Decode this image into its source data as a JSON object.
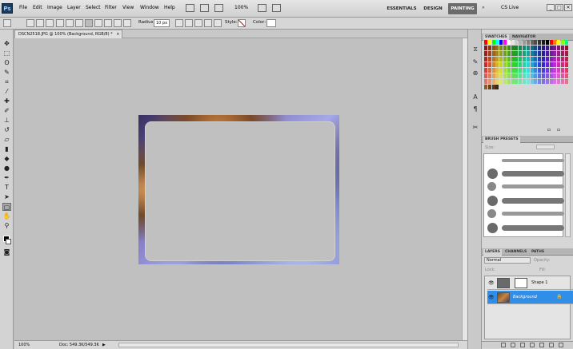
{
  "menubar": {
    "logo": "Ps",
    "items": [
      "File",
      "Edit",
      "Image",
      "Layer",
      "Select",
      "Filter",
      "View",
      "Window",
      "Help"
    ],
    "zoom_value": "100%",
    "workspaces": [
      "ESSENTIALS",
      "DESIGN",
      "PAINTING"
    ],
    "active_workspace": "PAINTING",
    "cs_live": "CS Live",
    "window_controls": [
      "_",
      "□",
      "✕"
    ]
  },
  "options_bar": {
    "radius_label": "Radius:",
    "radius_value": "10 px",
    "style_label": "Style:",
    "color_label": "Color:"
  },
  "document": {
    "tab_title": "DSCN2518.JPG @ 100% (Background, RGB/8) *",
    "tab_close": "×",
    "zoom": "100%",
    "doc_info": "Doc: 549.3K/549.3K"
  },
  "panels": {
    "swatches_tabs": [
      "SWATCHES",
      "NAVIGATOR"
    ],
    "brush_tab": "BRUSH PRESETS",
    "brush_size_label": "Size:",
    "layers_tabs": [
      "LAYERS",
      "CHANNELS",
      "PATHS"
    ],
    "blend_mode": "Normal",
    "opacity_label": "Opacity:",
    "lock_label": "Lock:",
    "fill_label": "Fill:",
    "layers": [
      {
        "name": "Shape 1",
        "selected": false
      },
      {
        "name": "Background",
        "selected": true
      }
    ]
  },
  "colors": {
    "accent_selected_layer": "#2f8fe8",
    "workspace_active": "#6b6b6b",
    "canvas_bg": "#c0c0c0"
  }
}
